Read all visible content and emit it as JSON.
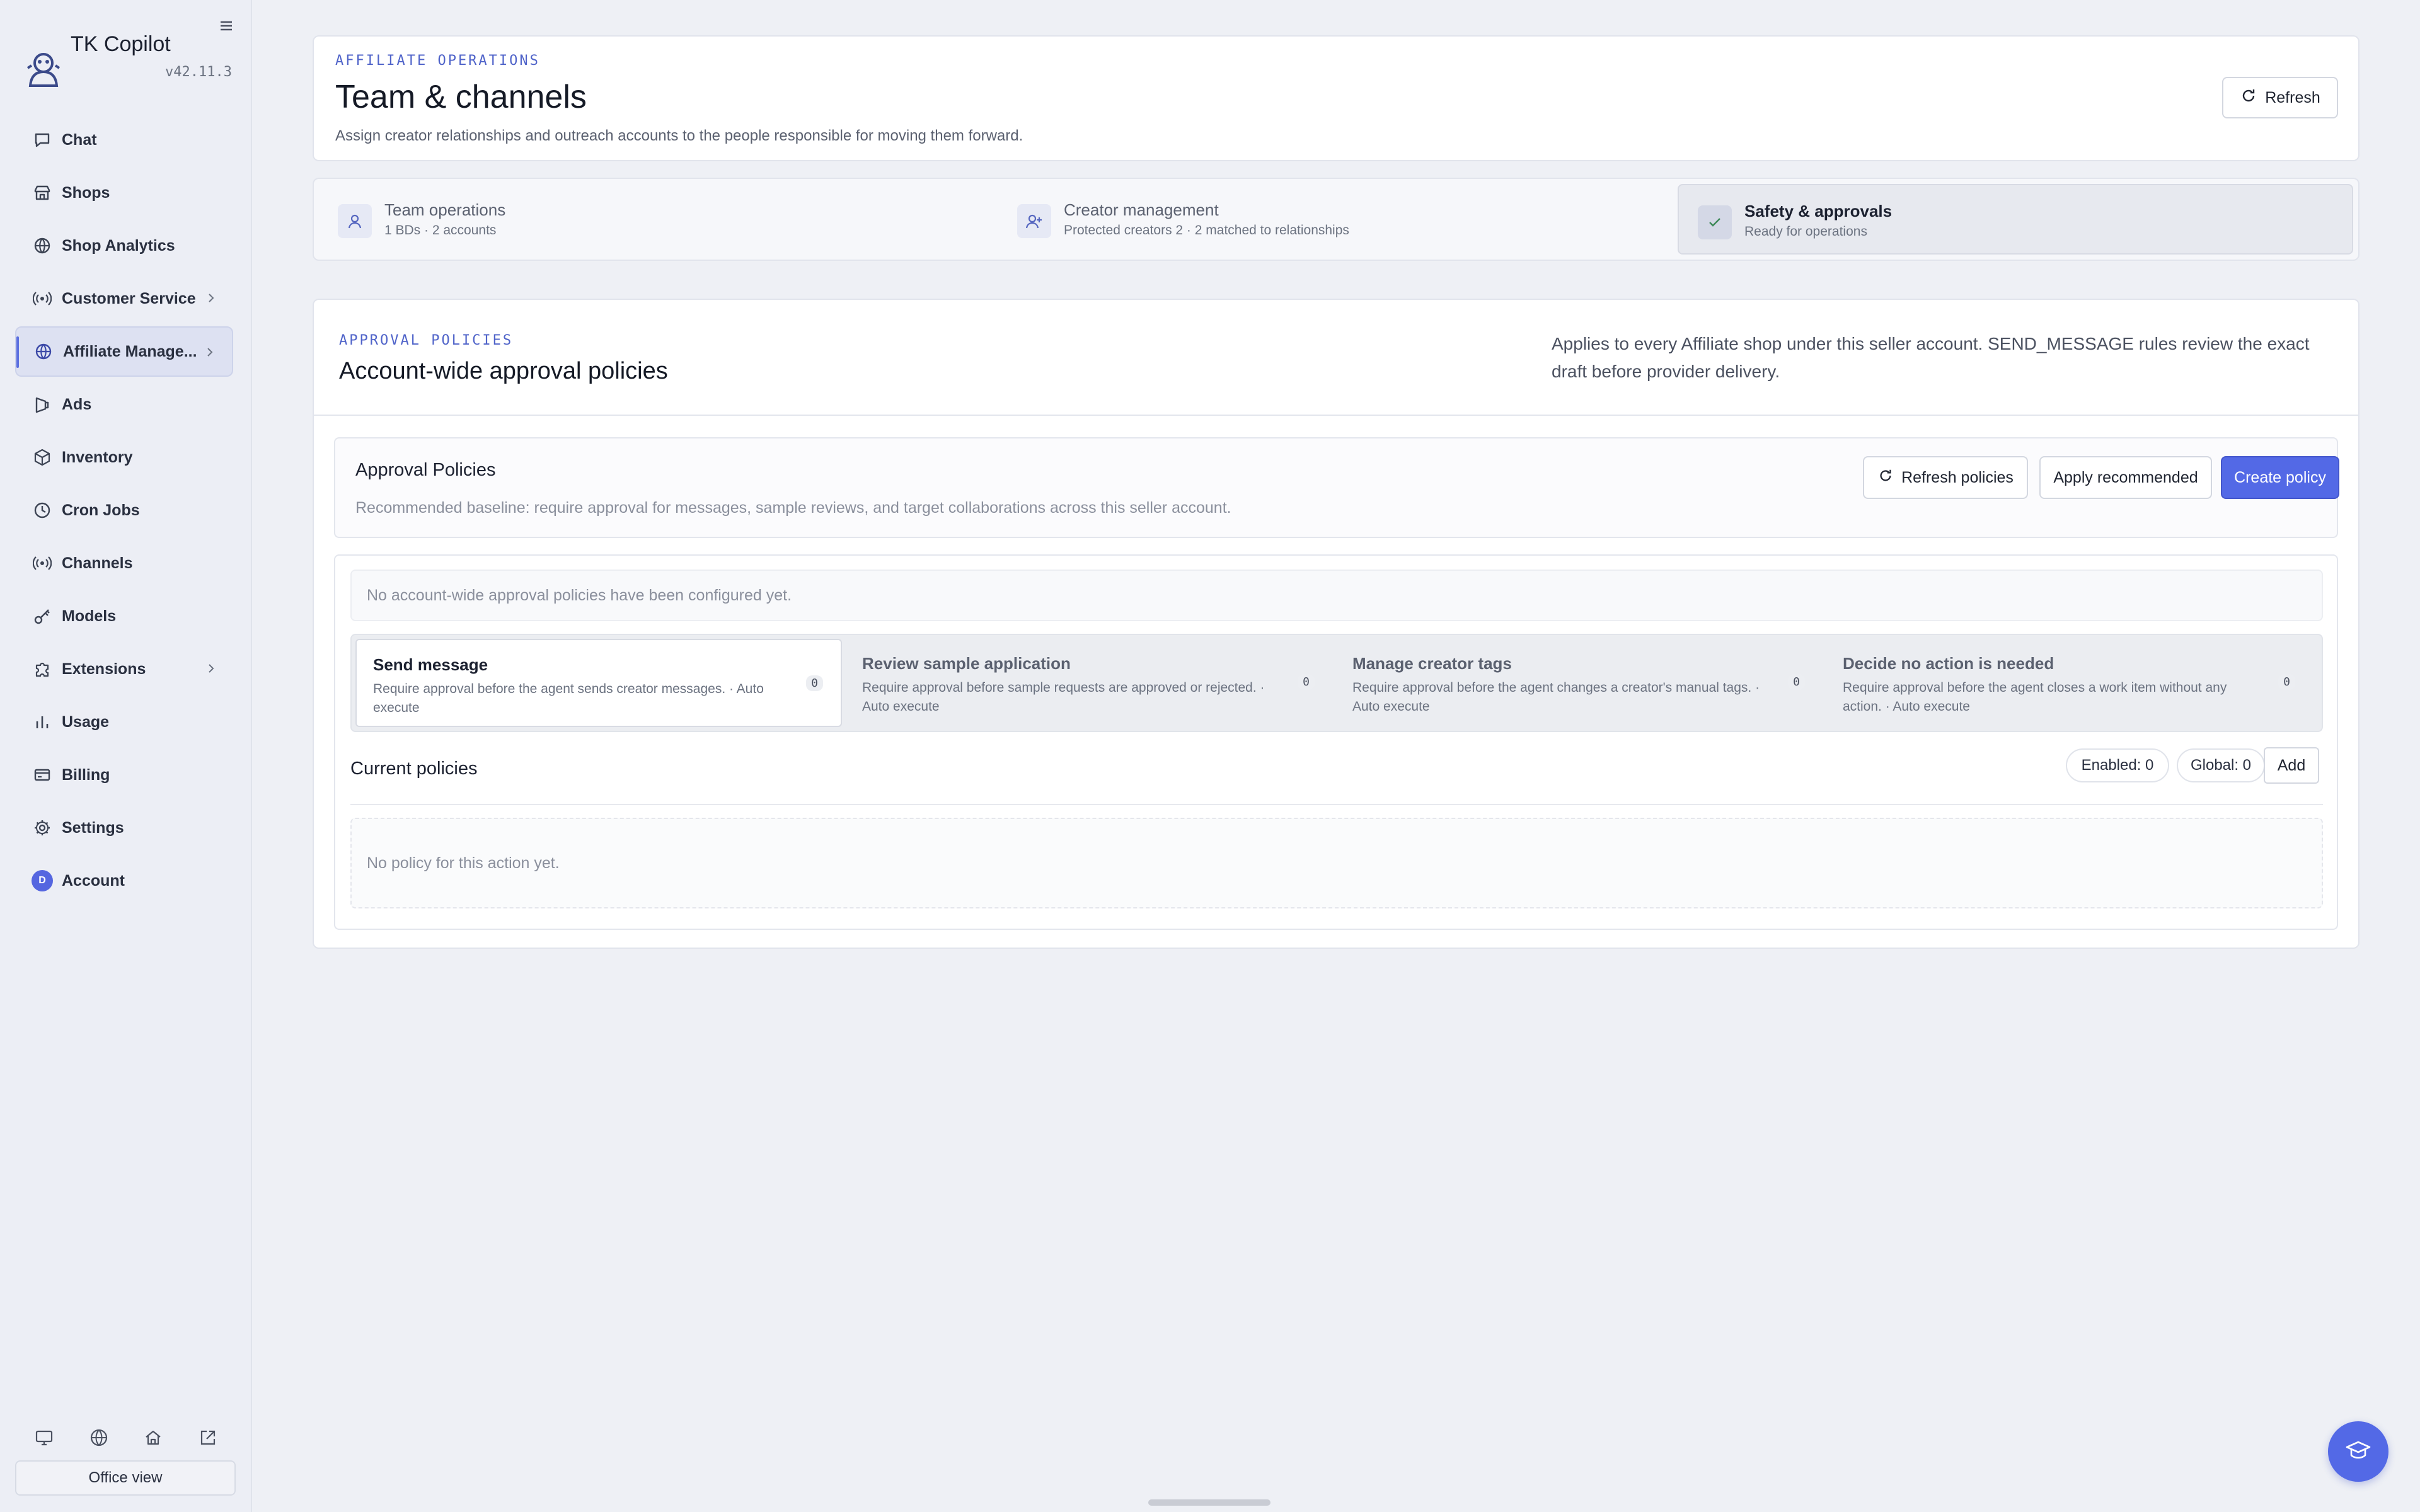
{
  "app": {
    "name": "TK Copilot",
    "version": "v42.11.3"
  },
  "sidebar": {
    "items": [
      {
        "label": "Chat",
        "icon": "chat-icon"
      },
      {
        "label": "Shops",
        "icon": "store-icon"
      },
      {
        "label": "Shop Analytics",
        "icon": "globe-icon"
      },
      {
        "label": "Customer Service",
        "icon": "broadcast-icon",
        "has_children": true
      },
      {
        "label": "Affiliate Manage...",
        "icon": "globe-icon",
        "has_children": true,
        "active": true
      },
      {
        "label": "Ads",
        "icon": "megaphone-icon"
      },
      {
        "label": "Inventory",
        "icon": "box-icon"
      },
      {
        "label": "Cron Jobs",
        "icon": "clock-icon"
      },
      {
        "label": "Channels",
        "icon": "broadcast-icon"
      },
      {
        "label": "Models",
        "icon": "key-icon"
      },
      {
        "label": "Extensions",
        "icon": "puzzle-icon",
        "has_children": true
      },
      {
        "label": "Usage",
        "icon": "bar-chart-icon"
      },
      {
        "label": "Billing",
        "icon": "billing-icon"
      },
      {
        "label": "Settings",
        "icon": "gear-icon"
      },
      {
        "label": "Account",
        "icon": "avatar",
        "avatar_initial": "D"
      }
    ],
    "bottom_icons": [
      "monitor-icon",
      "globe-icon",
      "home-icon",
      "external-link-icon"
    ],
    "office_view_label": "Office view"
  },
  "header": {
    "eyebrow": "AFFILIATE OPERATIONS",
    "title": "Team & channels",
    "subtitle": "Assign creator relationships and outreach accounts to the people responsible for moving them forward.",
    "refresh_label": "Refresh"
  },
  "steps": [
    {
      "title": "Team operations",
      "subtitle": "1 BDs · 2 accounts",
      "icon": "user-icon"
    },
    {
      "title": "Creator management",
      "subtitle": "Protected creators 2 · 2 matched to relationships",
      "icon": "user-plus-icon"
    },
    {
      "title": "Safety & approvals",
      "subtitle": "Ready for operations",
      "icon": "check-icon",
      "active": true
    }
  ],
  "policies": {
    "eyebrow": "APPROVAL POLICIES",
    "title": "Account-wide approval policies",
    "description": "Applies to every Affiliate shop under this seller account. SEND_MESSAGE rules review the exact draft before provider delivery.",
    "panel_title": "Approval Policies",
    "panel_subtitle": "Recommended baseline: require approval for messages, sample reviews, and target collaborations across this seller account.",
    "refresh_policies_label": "Refresh policies",
    "apply_recommended_label": "Apply recommended",
    "create_policy_label": "Create policy",
    "empty_message": "No account-wide approval policies have been configured yet.",
    "actions": [
      {
        "title": "Send message",
        "description": "Require approval before the agent sends creator messages. · Auto execute",
        "count": "0",
        "active": true
      },
      {
        "title": "Review sample application",
        "description": "Require approval before sample requests are approved or rejected. · Auto execute",
        "count": "0"
      },
      {
        "title": "Manage creator tags",
        "description": "Require approval before the agent changes a creator's manual tags. · Auto execute",
        "count": "0"
      },
      {
        "title": "Decide no action is needed",
        "description": "Require approval before the agent closes a work item without any action. · Auto execute",
        "count": "0"
      }
    ],
    "current_title": "Current policies",
    "enabled_label": "Enabled: 0",
    "global_label": "Global: 0",
    "add_label": "Add",
    "no_policy_message": "No policy for this action yet."
  },
  "colors": {
    "accent": "#5369e6",
    "sidebar_bg": "#eceef5",
    "page_bg": "#eef0f5"
  }
}
